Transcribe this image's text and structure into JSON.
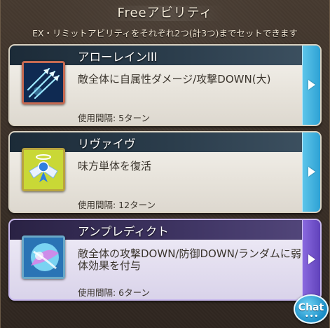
{
  "header": {
    "title": "Freeアビリティ",
    "subtitle": "EX・リミットアビリティをそれぞれ2つ(計3つ)までセットできます"
  },
  "abilities": [
    {
      "name": "アローレインIII",
      "description": "敵全体に自属性ダメージ/攻撃DOWN(大)",
      "cooldown": "使用間隔: 5ターン",
      "icon": "arrow-rain-icon",
      "selected": false
    },
    {
      "name": "リヴァイヴ",
      "description": "味方単体を復活",
      "cooldown": "使用間隔: 12ターン",
      "icon": "revive-icon",
      "selected": false
    },
    {
      "name": "アンプレディクト",
      "description": "敵全体の攻撃DOWN/防御DOWN/ランダムに弱体効果を付与",
      "cooldown": "使用間隔: 6ターン",
      "icon": "unpredict-icon",
      "selected": true
    }
  ],
  "chat": {
    "label": "Chat",
    "dots": "•••"
  },
  "colors": {
    "card_arrow": "#2a9fd3",
    "card_arrow_selected": "#5d3fb8",
    "background": "#3a2f27"
  }
}
